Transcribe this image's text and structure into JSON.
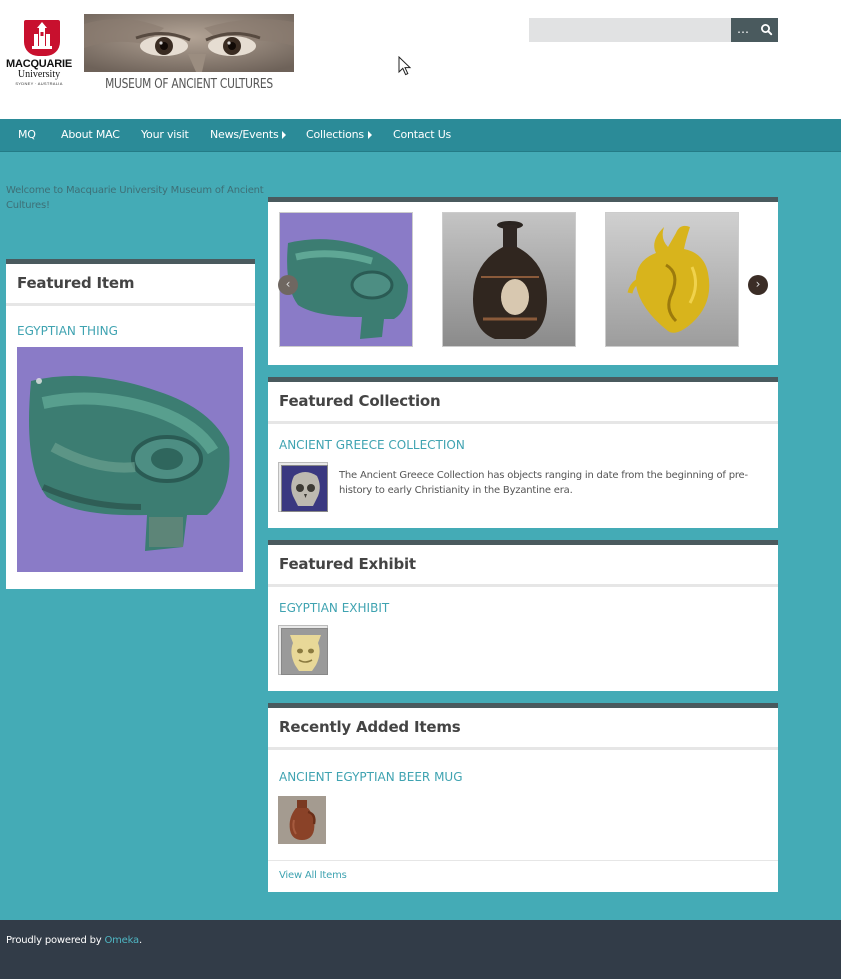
{
  "header": {
    "mq_logo": {
      "name": "MACQUARIE",
      "sub": "University",
      "tagline": "SYDNEY · AUSTRALIA"
    },
    "mac_title": "MUSEUM OF ANCIENT CULTURES",
    "search": {
      "value": "",
      "advanced_label": "…"
    }
  },
  "nav": {
    "items": [
      {
        "label": "MQ",
        "has_submenu": false
      },
      {
        "label": "About MAC",
        "has_submenu": false
      },
      {
        "label": "Your visit",
        "has_submenu": false
      },
      {
        "label": "News/Events",
        "has_submenu": true
      },
      {
        "label": "Collections",
        "has_submenu": true
      },
      {
        "label": "Contact Us",
        "has_submenu": false
      }
    ]
  },
  "welcome": "Welcome to Macquarie University Museum of Ancient Cultures!",
  "featured_item": {
    "title": "Featured Item",
    "item_title": "EGYPTIAN THING"
  },
  "carousel": {
    "prev_icon": "chevron-left-icon",
    "next_icon": "chevron-right-icon",
    "prev_glyph": "‹",
    "next_glyph": "›"
  },
  "featured_collection": {
    "title": "Featured Collection",
    "collection_title": "ANCIENT GREECE COLLECTION",
    "description": "The Ancient Greece Collection has objects ranging in date from the beginning of pre-history to early Christianity in the Byzantine era."
  },
  "featured_exhibit": {
    "title": "Featured Exhibit",
    "exhibit_title": "EGYPTIAN EXHIBIT"
  },
  "recent_items": {
    "title": "Recently Added Items",
    "item_title": "ANCIENT EGYPTIAN BEER MUG",
    "view_all": "View All Items"
  },
  "footer": {
    "prefix": "Proudly powered by ",
    "link": "Omeka",
    "suffix": "."
  },
  "colors": {
    "background": "#44abb6",
    "nav": "#2b8b98",
    "panel_border": "#4a5a5e",
    "link": "#3fa3b1",
    "footer": "#323c48",
    "mq_red": "#c8102e"
  }
}
